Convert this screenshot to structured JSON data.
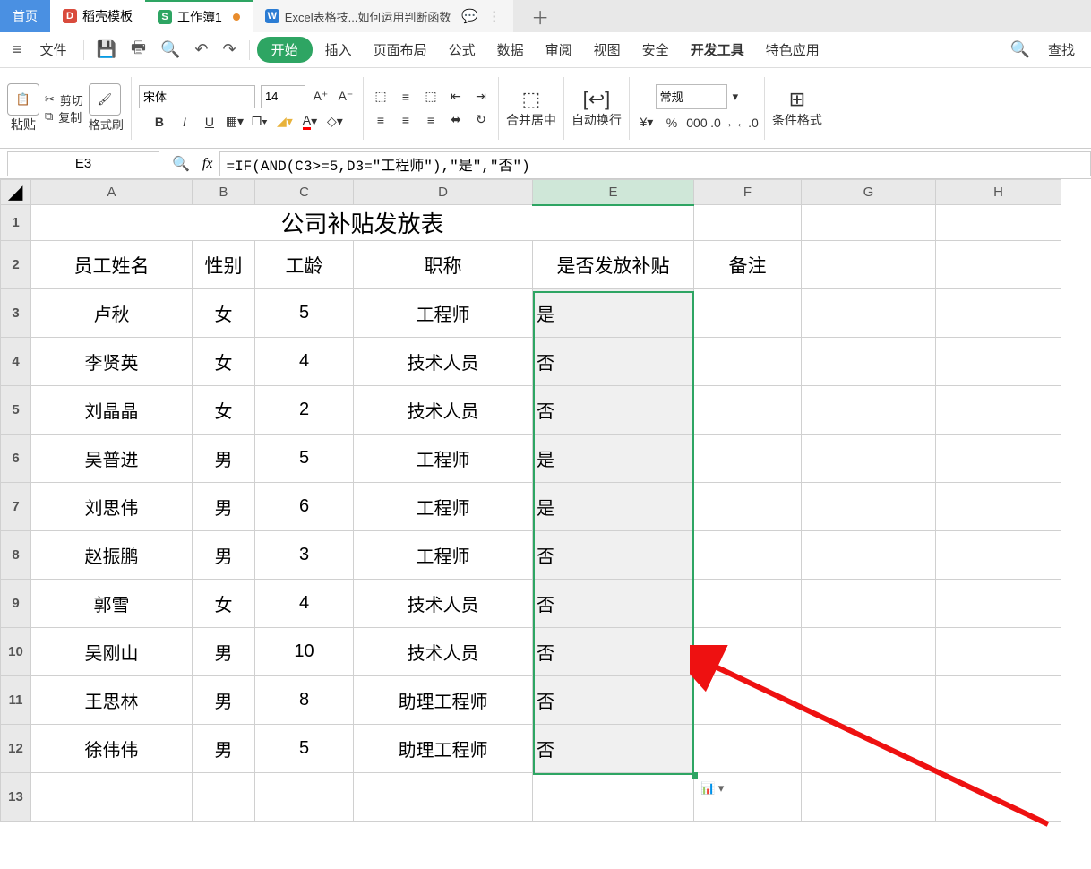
{
  "tabs": {
    "home": "首页",
    "docx": "稻壳模板",
    "sheet": "工作簿1",
    "help": "Excel表格技...如何运用判断函数"
  },
  "menubar": {
    "file": "文件",
    "start": "开始",
    "insert": "插入",
    "layout": "页面布局",
    "formula": "公式",
    "data": "数据",
    "review": "审阅",
    "view": "视图",
    "security": "安全",
    "dev": "开发工具",
    "special": "特色应用",
    "find": "查找"
  },
  "ribbon": {
    "paste": "粘贴",
    "cut": "剪切",
    "copy": "复制",
    "format_painter": "格式刷",
    "font": "宋体",
    "size": "14",
    "merge": "合并居中",
    "wrap": "自动换行",
    "numfmt": "常规",
    "condfmt": "条件格式"
  },
  "fbar": {
    "namebox": "E3",
    "formula": "=IF(AND(C3>=5,D3=\"工程师\"),\"是\",\"否\")"
  },
  "sheet": {
    "title": "公司补贴发放表",
    "cols": [
      "A",
      "B",
      "C",
      "D",
      "E",
      "F",
      "G",
      "H"
    ],
    "headers": {
      "A": "员工姓名",
      "B": "性别",
      "C": "工龄",
      "D": "职称",
      "E": "是否发放补贴",
      "F": "备注"
    },
    "rows": [
      {
        "A": "卢秋",
        "B": "女",
        "C": "5",
        "D": "工程师",
        "E": "是"
      },
      {
        "A": "李贤英",
        "B": "女",
        "C": "4",
        "D": "技术人员",
        "E": "否"
      },
      {
        "A": "刘晶晶",
        "B": "女",
        "C": "2",
        "D": "技术人员",
        "E": "否"
      },
      {
        "A": "吴普进",
        "B": "男",
        "C": "5",
        "D": "工程师",
        "E": "是"
      },
      {
        "A": "刘思伟",
        "B": "男",
        "C": "6",
        "D": "工程师",
        "E": "是"
      },
      {
        "A": "赵振鹏",
        "B": "男",
        "C": "3",
        "D": "工程师",
        "E": "否"
      },
      {
        "A": "郭雪",
        "B": "女",
        "C": "4",
        "D": "技术人员",
        "E": "否"
      },
      {
        "A": "吴刚山",
        "B": "男",
        "C": "10",
        "D": "技术人员",
        "E": "否"
      },
      {
        "A": "王思林",
        "B": "男",
        "C": "8",
        "D": "助理工程师",
        "E": "否"
      },
      {
        "A": "徐伟伟",
        "B": "男",
        "C": "5",
        "D": "助理工程师",
        "E": "否"
      }
    ]
  }
}
